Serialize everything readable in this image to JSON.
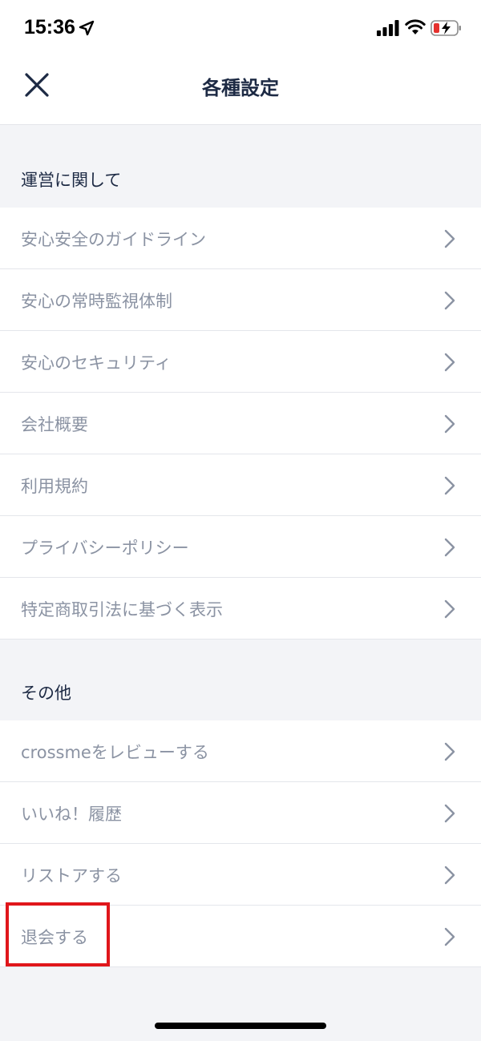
{
  "status": {
    "time": "15:36",
    "icons": [
      "location-arrow-icon",
      "signal-icon",
      "wifi-icon",
      "battery-charging-icon"
    ]
  },
  "header": {
    "title": "各種設定",
    "close_icon": "close-icon"
  },
  "sections": [
    {
      "title": "運営に関して",
      "items": [
        {
          "label": "安心安全のガイドライン"
        },
        {
          "label": "安心の常時監視体制"
        },
        {
          "label": "安心のセキュリティ"
        },
        {
          "label": "会社概要"
        },
        {
          "label": "利用規約"
        },
        {
          "label": "プライバシーポリシー"
        },
        {
          "label": "特定商取引法に基づく表示"
        }
      ]
    },
    {
      "title": "その他",
      "items": [
        {
          "label": "crossmeをレビューする"
        },
        {
          "label": "いいね！履歴"
        },
        {
          "label": "リストアする"
        },
        {
          "label": "退会する"
        }
      ]
    }
  ],
  "colors": {
    "highlight": "#e0161b",
    "label_gray": "#8b93a3",
    "title_navy": "#1d2a44",
    "background": "#f3f4f7"
  }
}
